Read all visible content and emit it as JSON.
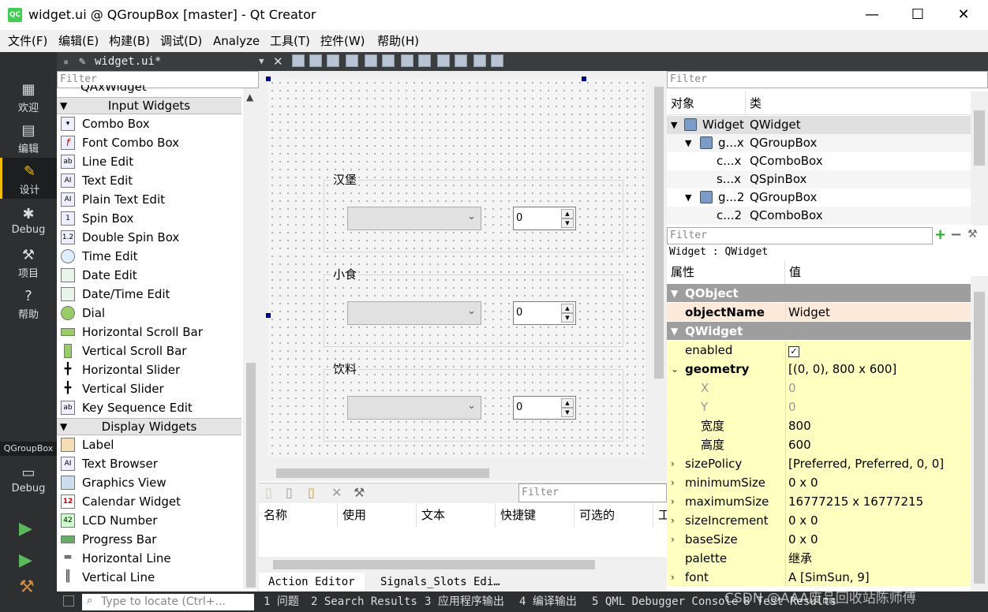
{
  "window": {
    "title": "widget.ui @ QGroupBox [master] - Qt Creator",
    "icon_label": "QC",
    "minimize": "—",
    "maximize": "☐",
    "close": "✕"
  },
  "menu": [
    "文件(F)",
    "编辑(E)",
    "构建(B)",
    "调试(D)",
    "Analyze",
    "工具(T)",
    "控件(W)",
    "帮助(H)"
  ],
  "modes": [
    {
      "label": "欢迎",
      "icon": "grid-icon"
    },
    {
      "label": "编辑",
      "icon": "document-icon"
    },
    {
      "label": "设计",
      "icon": "pencil-icon"
    },
    {
      "label": "Debug",
      "icon": "bug-icon"
    },
    {
      "label": "项目",
      "icon": "wrench-icon"
    },
    {
      "label": "帮助",
      "icon": "help-icon"
    }
  ],
  "kit": {
    "target": "QGroupBox",
    "mode": "Debug"
  },
  "doc_tab": {
    "filename": "widget.ui*"
  },
  "widget_box": {
    "filter_placeholder": "Filter",
    "partial_item": "QAxWidget",
    "categories": [
      {
        "name": "Input Widgets",
        "items": [
          "Combo Box",
          "Font Combo Box",
          "Line Edit",
          "Text Edit",
          "Plain Text Edit",
          "Spin Box",
          "Double Spin Box",
          "Time Edit",
          "Date Edit",
          "Date/Time Edit",
          "Dial",
          "Horizontal Scroll Bar",
          "Vertical Scroll Bar",
          "Horizontal Slider",
          "Vertical Slider",
          "Key Sequence Edit"
        ]
      },
      {
        "name": "Display Widgets",
        "items": [
          "Label",
          "Text Browser",
          "Graphics View",
          "Calendar Widget",
          "LCD Number",
          "Progress Bar",
          "Horizontal Line",
          "Vertical Line"
        ]
      }
    ]
  },
  "form": {
    "groups": [
      {
        "title": "汉堡",
        "spin_value": "0"
      },
      {
        "title": "小食",
        "spin_value": "0"
      },
      {
        "title": "饮料",
        "spin_value": "0"
      }
    ]
  },
  "action_editor": {
    "filter_placeholder": "Filter",
    "columns": [
      "名称",
      "使用",
      "文本",
      "快捷键",
      "可选的",
      "工"
    ],
    "tabs": [
      "Action Editor",
      "Signals_Slots Edi…"
    ]
  },
  "object_inspector": {
    "filter_placeholder": "Filter",
    "headers": [
      "对象",
      "类"
    ],
    "rows": [
      {
        "object": "Widget",
        "class": "QWidget",
        "level": 0,
        "expanded": true
      },
      {
        "object": "g...x",
        "class": "QGroupBox",
        "level": 1,
        "expanded": true
      },
      {
        "object": "c...x",
        "class": "QComboBox",
        "level": 2
      },
      {
        "object": "s...x",
        "class": "QSpinBox",
        "level": 2
      },
      {
        "object": "g...2",
        "class": "QGroupBox",
        "level": 1,
        "expanded": true
      },
      {
        "object": "c...2",
        "class": "QComboBox",
        "level": 2
      }
    ]
  },
  "property_editor": {
    "filter_placeholder": "Filter",
    "caption": "Widget : QWidget",
    "headers": [
      "属性",
      "值"
    ],
    "rows": [
      {
        "kind": "category",
        "name": "QObject"
      },
      {
        "kind": "prop",
        "name": "objectName",
        "value": "Widget",
        "bold": true,
        "bg": "peach"
      },
      {
        "kind": "category",
        "name": "QWidget"
      },
      {
        "kind": "prop",
        "name": "enabled",
        "value": "✓",
        "checkbox": true
      },
      {
        "kind": "prop",
        "name": "geometry",
        "value": "[(0, 0), 800 x 600]",
        "bold": true,
        "expander": "⌄"
      },
      {
        "kind": "sub",
        "name": "X",
        "value": "0",
        "dim": true
      },
      {
        "kind": "sub",
        "name": "Y",
        "value": "0",
        "dim": true
      },
      {
        "kind": "sub",
        "name": "宽度",
        "value": "800"
      },
      {
        "kind": "sub",
        "name": "高度",
        "value": "600"
      },
      {
        "kind": "prop",
        "name": "sizePolicy",
        "value": "[Preferred, Preferred, 0, 0]",
        "expander": "›"
      },
      {
        "kind": "prop",
        "name": "minimumSize",
        "value": "0 x 0",
        "expander": "›"
      },
      {
        "kind": "prop",
        "name": "maximumSize",
        "value": "16777215 x 16777215",
        "expander": "›"
      },
      {
        "kind": "prop",
        "name": "sizeIncrement",
        "value": "0 x 0",
        "expander": "›"
      },
      {
        "kind": "prop",
        "name": "baseSize",
        "value": "0 x 0",
        "expander": "›"
      },
      {
        "kind": "prop",
        "name": "palette",
        "value": "继承"
      },
      {
        "kind": "prop",
        "name": "font",
        "value": "A  [SimSun, 9]",
        "expander": "›"
      }
    ]
  },
  "statusbar": {
    "locator_placeholder": "Type to locate (Ctrl+...",
    "panes": [
      "1 问题",
      "2 Search Results",
      "3 应用程序输出",
      "4 编译输出",
      "5 QML Debugger Console",
      "8 Test Results"
    ]
  },
  "watermark": "CSDN @AAA废品回收站陈师傅"
}
